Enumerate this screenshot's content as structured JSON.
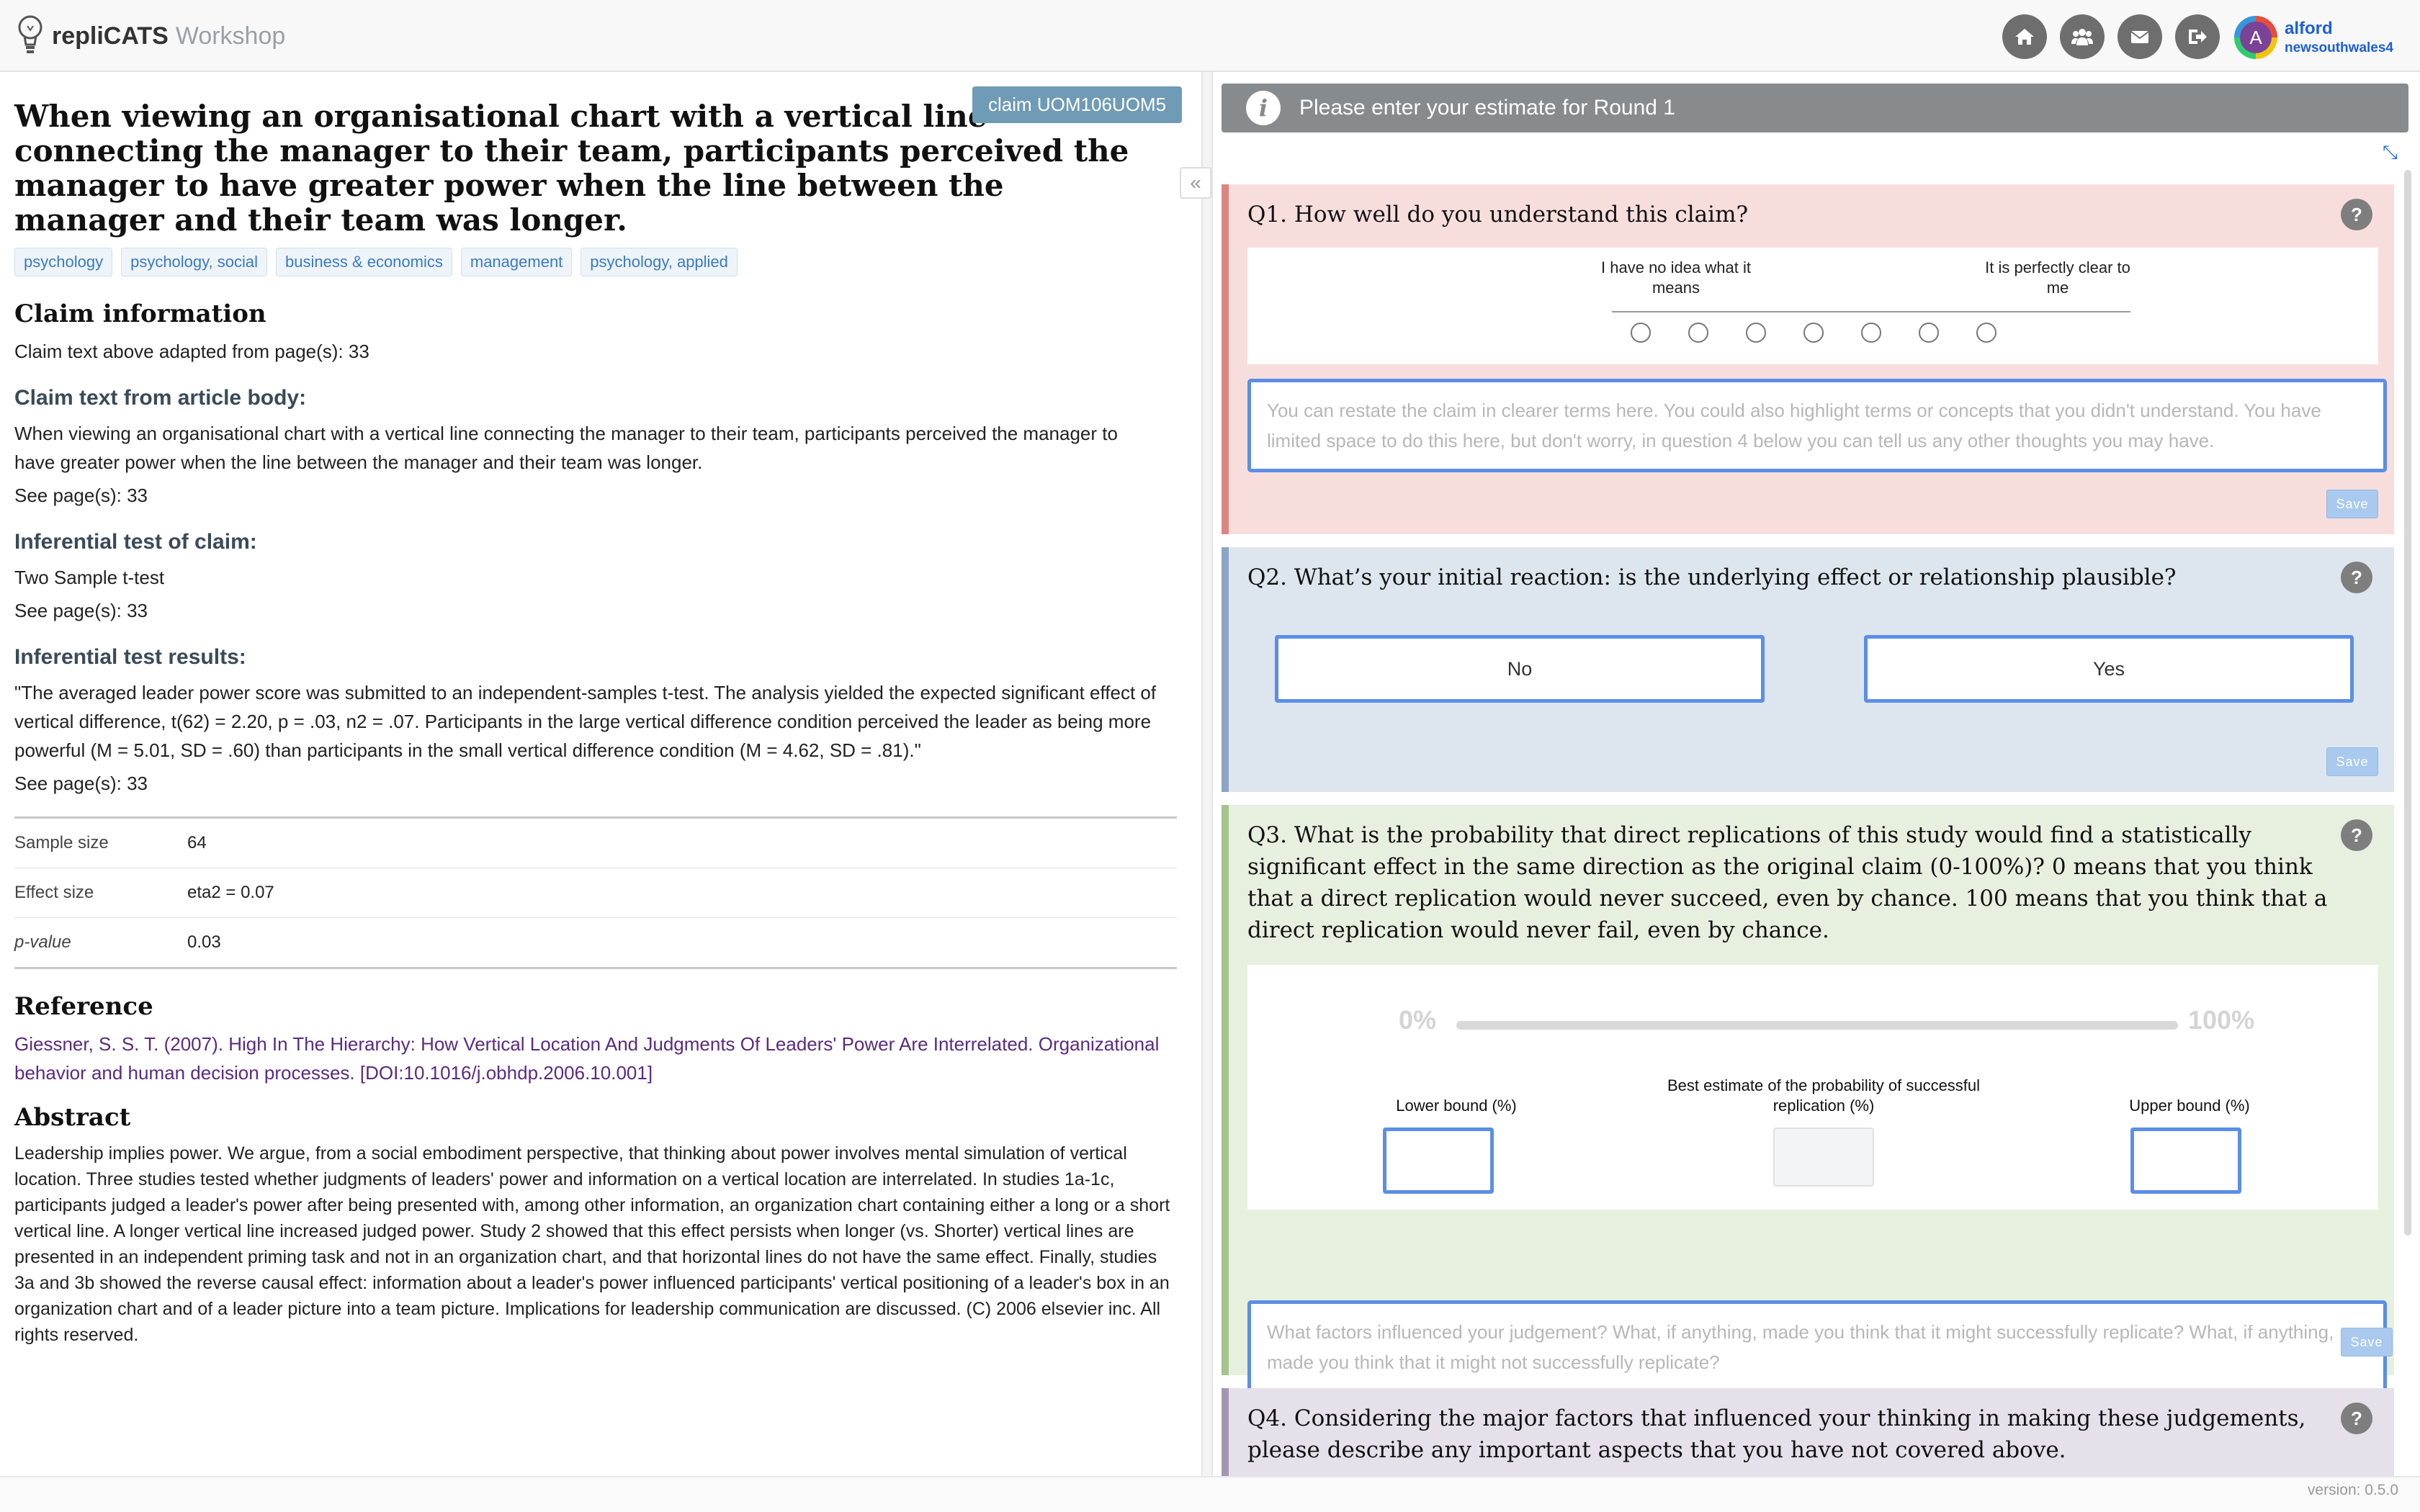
{
  "app": {
    "brand_bold": "repliCATS",
    "brand_light": "Workshop"
  },
  "user": {
    "name": "alford",
    "group": "newsouthwales4",
    "initial": "A"
  },
  "nav": [
    "home-icon",
    "group-icon",
    "mail-icon",
    "logout-icon"
  ],
  "claim": {
    "badge": "claim UOM106UOM5",
    "title": "When viewing an organisational chart with a vertical line connecting the manager to their team, participants perceived the manager to have greater power when the line between the manager and their team was longer.",
    "tags": [
      "psychology",
      "psychology, social",
      "business & economics",
      "management",
      "psychology, applied"
    ],
    "info_heading": "Claim information",
    "adapted": "Claim text above adapted from page(s): 33",
    "body_heading": "Claim text from article body:",
    "body_text": "When viewing an organisational chart with a vertical line connecting the manager to their team, participants perceived the manager to have greater power when the line between the manager and their team was longer.",
    "body_pages": "See page(s): 33",
    "test_heading": "Inferential test of claim:",
    "test_text": "Two Sample t-test",
    "test_pages": "See page(s): 33",
    "results_heading": "Inferential test results:",
    "results_text": "\"The averaged leader power score was submitted to an independent-samples t-test. The analysis yielded the expected significant effect of vertical difference, t(62) = 2.20, p = .03, n2 = .07. Participants in the large vertical difference condition perceived the leader as being more powerful (M = 5.01, SD = .60) than participants in the small vertical difference condition (M = 4.62, SD = .81).\"",
    "results_pages": "See page(s): 33",
    "stats": [
      {
        "key": "Sample size",
        "value": "64"
      },
      {
        "key": "Effect size",
        "value": "eta2 = 0.07"
      },
      {
        "key": "p-value",
        "value": "0.03"
      }
    ],
    "reference_heading": "Reference",
    "reference": "Giessner, S. S. T. (2007). High In The Hierarchy: How Vertical Location And Judgments Of Leaders' Power Are Interrelated. Organizational behavior and human decision processes. [DOI:10.1016/j.obhdp.2006.10.001]",
    "abstract_heading": "Abstract",
    "abstract": "Leadership implies power. We argue, from a social embodiment perspective, that thinking about power involves mental simulation of vertical location. Three studies tested whether judgments of leaders' power and information on a vertical location are interrelated. In studies 1a-1c, participants judged a leader's power after being presented with, among other information, an organization chart containing either a long or a short vertical line. A longer vertical line increased judged power. Study 2 showed that this effect persists when longer (vs. Shorter) vertical lines are presented in an independent priming task and not in an organization chart, and that horizontal lines do not have the same effect. Finally, studies 3a and 3b showed the reverse causal effect: information about a leader's power influenced participants' vertical positioning of a leader's box in an organization chart and of a leader picture into a team picture. Implications for leadership communication are discussed. (C) 2006 elsevier inc. All rights reserved."
  },
  "panel": {
    "banner": "Please enter your estimate for Round 1",
    "collapse_label": "«",
    "save_label": "Save",
    "q1": {
      "title": "Q1. How well do you understand this claim?",
      "left_label": "I have no idea what it means",
      "right_label": "It is perfectly clear to me",
      "options": 7,
      "placeholder": "You can restate the claim in clearer terms here. You could also highlight terms or concepts that you didn't understand. You have limited space to do this here, but don't worry, in question 4 below you can tell us any other thoughts you may have."
    },
    "q2": {
      "title": "Q2. What’s your initial reaction: is the underlying effect or relationship plausible?",
      "no": "No",
      "yes": "Yes"
    },
    "q3": {
      "title": "Q3. What is the probability that direct replications of this study would find a statistically significant effect in the same direction as the original claim (0-100%)? 0 means that you think that a direct replication would never succeed, even by chance. 100 means that you think that a direct replication would never fail, even by chance.",
      "min": "0%",
      "max": "100%",
      "lower": "Lower bound (%)",
      "best": "Best estimate of the probability of successful replication (%)",
      "upper": "Upper bound (%)",
      "placeholder": "What factors influenced your judgement? What, if anything, made you think that it might successfully replicate? What, if anything, made you think that it might not successfully replicate?"
    },
    "q4": {
      "title": "Q4. Considering the major factors that influenced your thinking in making these judgements, please describe any important aspects that you have not covered above."
    }
  },
  "version": "version: 0.5.0"
}
